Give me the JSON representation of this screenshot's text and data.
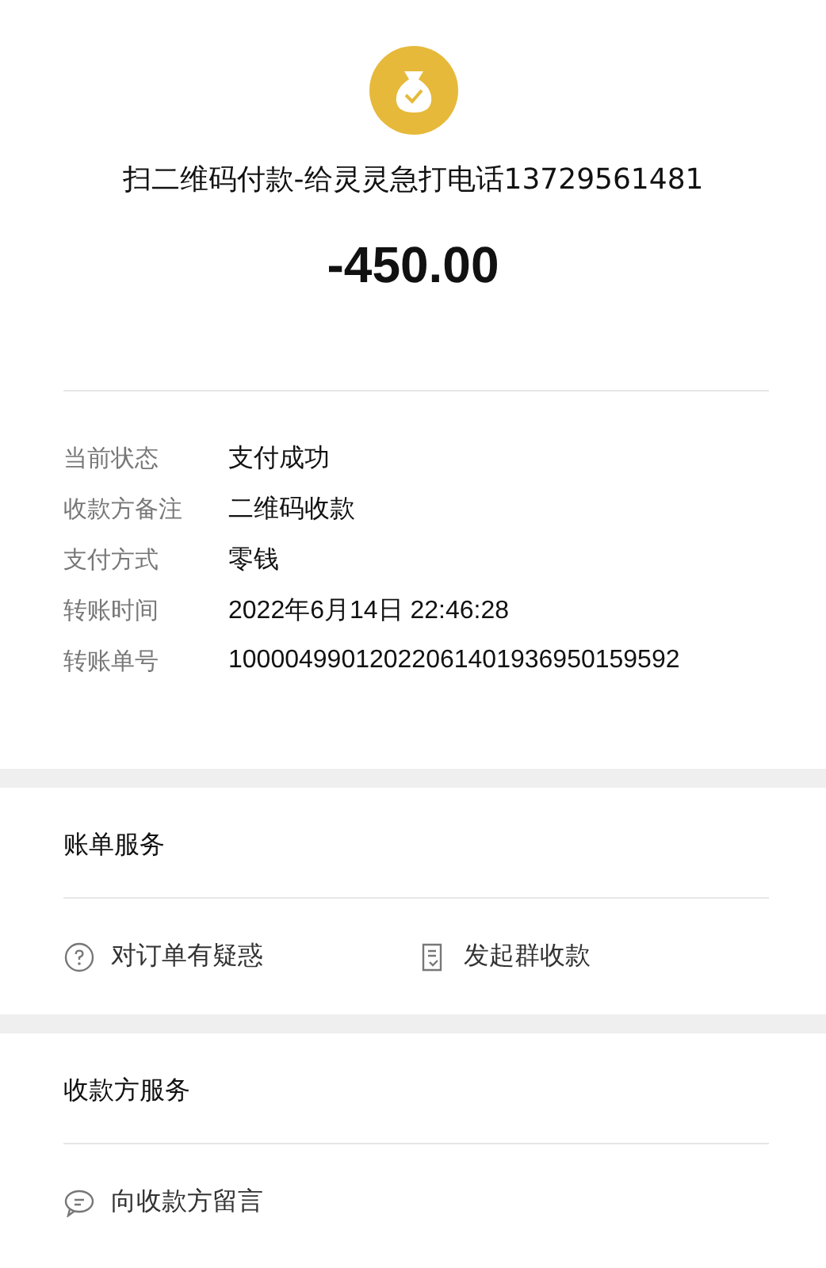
{
  "payment": {
    "title": "扫二维码付款-给灵灵急打电话13729561481",
    "amount": "-450.00"
  },
  "details": [
    {
      "label": "当前状态",
      "value": "支付成功"
    },
    {
      "label": "收款方备注",
      "value": "二维码收款"
    },
    {
      "label": "支付方式",
      "value": "零钱"
    },
    {
      "label": "转账时间",
      "value": "2022年6月14日 22:46:28"
    },
    {
      "label": "转账单号",
      "value": "10000499012022061401936950159592"
    }
  ],
  "sections": [
    {
      "title": "账单服务",
      "actions": [
        {
          "kind": "question",
          "label": "对订单有疑惑"
        },
        {
          "kind": "bill",
          "label": "发起群收款"
        }
      ]
    },
    {
      "title": "收款方服务",
      "actions": [
        {
          "kind": "message",
          "label": "向收款方留言"
        }
      ]
    }
  ]
}
